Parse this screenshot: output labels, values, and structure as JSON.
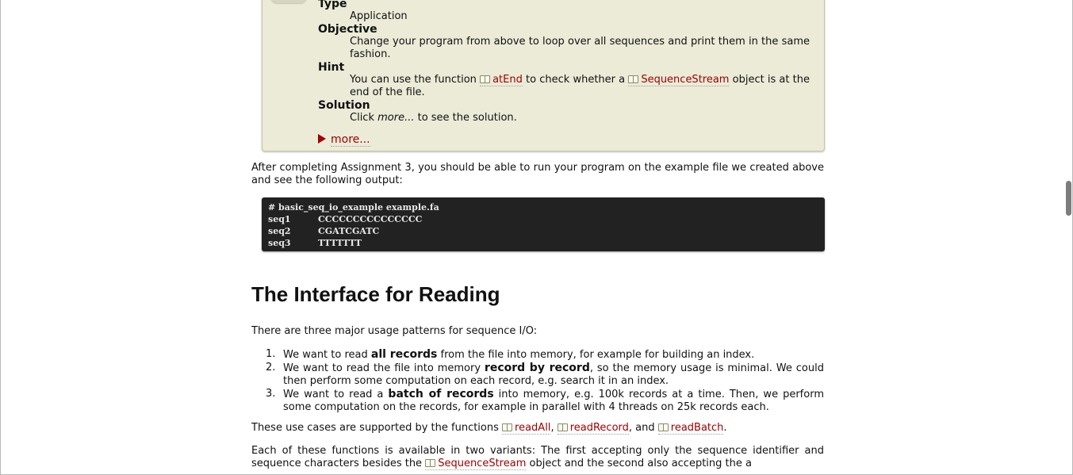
{
  "assignment": {
    "type_label": "Type",
    "type_value": "Application",
    "objective_label": "Objective",
    "objective_text": "Change your program from above to loop over all sequences and print them in the same fashion.",
    "hint_label": "Hint",
    "hint_pre": "You can use the function ",
    "hint_ref1": "atEnd",
    "hint_mid": " to check whether a ",
    "hint_ref2": "SequenceStream",
    "hint_post": " object is at the end of the file.",
    "solution_label": "Solution",
    "solution_pre": "Click ",
    "solution_em": "more...",
    "solution_post": " to see the solution.",
    "more_label": "more..."
  },
  "after_text": "After completing Assignment 3, you should be able to run your program on the example file we created above and see the following output:",
  "code": {
    "command": "# basic_seq_io_example example.fa",
    "rows": [
      {
        "id": "seq1",
        "seq": "CCCCCCCCCCCCCCC"
      },
      {
        "id": "seq2",
        "seq": "CGATCGATC"
      },
      {
        "id": "seq3",
        "seq": "TTTTTTT"
      }
    ]
  },
  "heading": "The Interface for Reading",
  "intro": "There are three major usage patterns for sequence I/O:",
  "list": [
    {
      "num": "1.",
      "pre": "We want to read ",
      "bold": "all records",
      "post": " from the file into memory, for example for building an index."
    },
    {
      "num": "2.",
      "pre": "We want to read the file into memory ",
      "bold": "record by record",
      "post": ", so the memory usage is minimal. We could then perform some computation on each record, e.g. search it in an index."
    },
    {
      "num": "3.",
      "pre": "We want to read a ",
      "bold": "batch of records",
      "post": " into memory, e.g. 100k records at a time. Then, we perform some computation on the records, for example in parallel with 4 threads on 25k records each."
    }
  ],
  "use_cases": {
    "pre": "These use cases are supported by the functions ",
    "ref1": "readAll",
    "sep1": ", ",
    "ref2": "readRecord",
    "sep2": ", and ",
    "ref3": "readBatch",
    "post": "."
  },
  "variants": {
    "pre": "Each of these functions is available in two variants: The first accepting only the sequence identifier and sequence characters besides the ",
    "ref": "SequenceStream",
    "post": " object and the second also accepting the a"
  }
}
